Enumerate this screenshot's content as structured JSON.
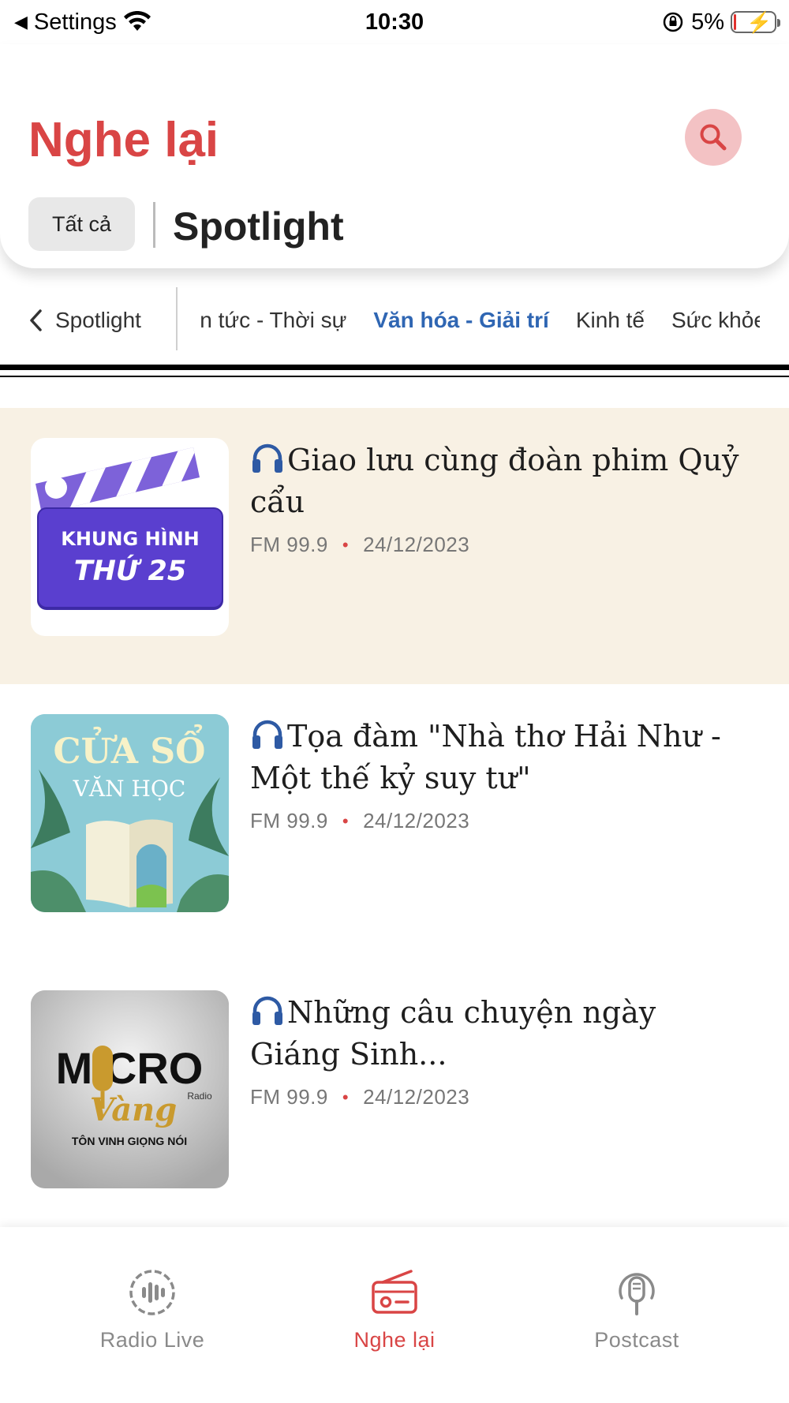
{
  "status_bar": {
    "back_label": "Settings",
    "time": "10:30",
    "battery": "5%"
  },
  "header": {
    "title": "Nghe lại",
    "chip_all": "Tất cả",
    "section_title": "Spotlight"
  },
  "categories": {
    "back_label": "Spotlight",
    "items": [
      {
        "label": "Tin tức - Thời sự",
        "active": false
      },
      {
        "label": "Văn hóa - Giải trí",
        "active": true
      },
      {
        "label": "Kinh tế",
        "active": false
      },
      {
        "label": "Sức khỏe",
        "active": false
      }
    ]
  },
  "episodes": [
    {
      "title": "Giao lưu cùng đoàn phim Quỷ cẩu",
      "station": "FM 99.9",
      "date": "24/12/2023",
      "highlighted": true,
      "thumb": {
        "line1": "KHUNG HÌNH",
        "line2": "THỨ 25"
      }
    },
    {
      "title": "Tọa đàm \"Nhà thơ Hải Như - Một thế kỷ suy tư\"",
      "station": "FM 99.9",
      "date": "24/12/2023",
      "highlighted": false,
      "thumb": {
        "line1": "CỬA SỔ",
        "line2": "VĂN HỌC"
      }
    },
    {
      "title": "Những câu chuyện ngày Giáng Sinh...",
      "station": "FM 99.9",
      "date": "24/12/2023",
      "highlighted": false,
      "thumb": {
        "line1": "MICRO",
        "line2": "Vàng",
        "line3": "TÔN VINH GIỌNG NÓI",
        "badge": "Radio"
      }
    }
  ],
  "bottom_nav": [
    {
      "label": "Radio Live",
      "icon": "radio-wave-icon",
      "active": false
    },
    {
      "label": "Nghe lại",
      "icon": "radio-set-icon",
      "active": true
    },
    {
      "label": "Postcast",
      "icon": "podcast-mic-icon",
      "active": false
    }
  ],
  "colors": {
    "accent": "#d94545",
    "active_category": "#2f66b3",
    "highlight_row": "#f8f1e4"
  }
}
